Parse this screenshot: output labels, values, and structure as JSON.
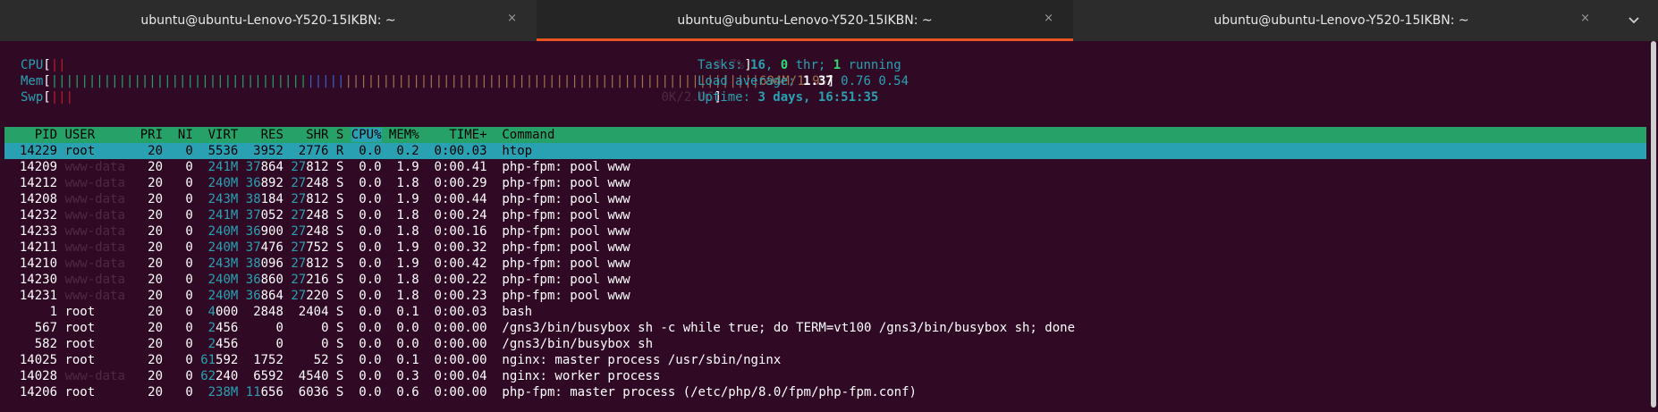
{
  "tabs": [
    {
      "title": "ubuntu@ubuntu-Lenovo-Y520-15IKBN: ~",
      "close": "×",
      "active": false
    },
    {
      "title": "ubuntu@ubuntu-Lenovo-Y520-15IKBN: ~",
      "close": "×",
      "active": true
    },
    {
      "title": "ubuntu@ubuntu-Lenovo-Y520-15IKBN: ~",
      "close": "×",
      "active": false
    }
  ],
  "tab_menu_icon": "chevron-down-icon",
  "meters": {
    "cpu_label": "CPU",
    "mem_label": "Mem",
    "mem_value": "694M/1.9",
    "swp_label": "Swp"
  },
  "summary": {
    "tasks_label": "Tasks: ",
    "tasks": "16",
    "thr_sep": ", ",
    "thr": "0",
    "thr_label": " thr; ",
    "running": "1",
    "running_label": " running",
    "load_label": "Load average: ",
    "load1": "1.37",
    "load5": "0.76",
    "load15": "0.54",
    "uptime_label": "Uptime: ",
    "uptime": "3 days, 16:51:35"
  },
  "columns": [
    "PID",
    "USER",
    "PRI",
    "NI",
    "VIRT",
    "RES",
    "SHR",
    "S",
    "CPU%",
    "MEM%",
    "TIME+",
    "Command"
  ],
  "processes": [
    {
      "pid": "14229",
      "user": "root",
      "pri": "20",
      "ni": "0",
      "virt": "5536",
      "res": "3952",
      "shr": "2776",
      "s": "R",
      "cpu": "0.0",
      "mem": "0.2",
      "time": "0:00.03",
      "cmd": "htop"
    },
    {
      "pid": "14209",
      "user": "www-data",
      "pri": "20",
      "ni": "0",
      "virt": "241M",
      "res": "37864",
      "shr": "27812",
      "s": "S",
      "cpu": "0.0",
      "mem": "1.9",
      "time": "0:00.41",
      "cmd": "php-fpm: pool www"
    },
    {
      "pid": "14212",
      "user": "www-data",
      "pri": "20",
      "ni": "0",
      "virt": "240M",
      "res": "36892",
      "shr": "27248",
      "s": "S",
      "cpu": "0.0",
      "mem": "1.8",
      "time": "0:00.29",
      "cmd": "php-fpm: pool www"
    },
    {
      "pid": "14208",
      "user": "www-data",
      "pri": "20",
      "ni": "0",
      "virt": "243M",
      "res": "38184",
      "shr": "27812",
      "s": "S",
      "cpu": "0.0",
      "mem": "1.9",
      "time": "0:00.44",
      "cmd": "php-fpm: pool www"
    },
    {
      "pid": "14232",
      "user": "www-data",
      "pri": "20",
      "ni": "0",
      "virt": "241M",
      "res": "37052",
      "shr": "27248",
      "s": "S",
      "cpu": "0.0",
      "mem": "1.8",
      "time": "0:00.24",
      "cmd": "php-fpm: pool www"
    },
    {
      "pid": "14233",
      "user": "www-data",
      "pri": "20",
      "ni": "0",
      "virt": "240M",
      "res": "36900",
      "shr": "27248",
      "s": "S",
      "cpu": "0.0",
      "mem": "1.8",
      "time": "0:00.16",
      "cmd": "php-fpm: pool www"
    },
    {
      "pid": "14211",
      "user": "www-data",
      "pri": "20",
      "ni": "0",
      "virt": "240M",
      "res": "37476",
      "shr": "27752",
      "s": "S",
      "cpu": "0.0",
      "mem": "1.9",
      "time": "0:00.32",
      "cmd": "php-fpm: pool www"
    },
    {
      "pid": "14210",
      "user": "www-data",
      "pri": "20",
      "ni": "0",
      "virt": "243M",
      "res": "38096",
      "shr": "27812",
      "s": "S",
      "cpu": "0.0",
      "mem": "1.9",
      "time": "0:00.42",
      "cmd": "php-fpm: pool www"
    },
    {
      "pid": "14230",
      "user": "www-data",
      "pri": "20",
      "ni": "0",
      "virt": "240M",
      "res": "36860",
      "shr": "27216",
      "s": "S",
      "cpu": "0.0",
      "mem": "1.8",
      "time": "0:00.22",
      "cmd": "php-fpm: pool www"
    },
    {
      "pid": "14231",
      "user": "www-data",
      "pri": "20",
      "ni": "0",
      "virt": "240M",
      "res": "36864",
      "shr": "27220",
      "s": "S",
      "cpu": "0.0",
      "mem": "1.8",
      "time": "0:00.23",
      "cmd": "php-fpm: pool www"
    },
    {
      "pid": "1",
      "user": "root",
      "pri": "20",
      "ni": "0",
      "virt": "4000",
      "res": "2848",
      "shr": "2404",
      "s": "S",
      "cpu": "0.0",
      "mem": "0.1",
      "time": "0:00.03",
      "cmd": "bash"
    },
    {
      "pid": "567",
      "user": "root",
      "pri": "20",
      "ni": "0",
      "virt": "2456",
      "res": "0",
      "shr": "0",
      "s": "S",
      "cpu": "0.0",
      "mem": "0.0",
      "time": "0:00.00",
      "cmd": "/gns3/bin/busybox sh -c while true; do TERM=vt100 /gns3/bin/busybox sh; done"
    },
    {
      "pid": "582",
      "user": "root",
      "pri": "20",
      "ni": "0",
      "virt": "2456",
      "res": "0",
      "shr": "0",
      "s": "S",
      "cpu": "0.0",
      "mem": "0.0",
      "time": "0:00.00",
      "cmd": "/gns3/bin/busybox sh"
    },
    {
      "pid": "14025",
      "user": "root",
      "pri": "20",
      "ni": "0",
      "virt": "61592",
      "res": "1752",
      "shr": "52",
      "s": "S",
      "cpu": "0.0",
      "mem": "0.1",
      "time": "0:00.00",
      "cmd": "nginx: master process /usr/sbin/nginx"
    },
    {
      "pid": "14028",
      "user": "www-data",
      "pri": "20",
      "ni": "0",
      "virt": "62240",
      "res": "6592",
      "shr": "4540",
      "s": "S",
      "cpu": "0.0",
      "mem": "0.3",
      "time": "0:00.04",
      "cmd": "nginx: worker process"
    },
    {
      "pid": "14206",
      "user": "root",
      "pri": "20",
      "ni": "0",
      "virt": "238M",
      "res": "11656",
      "shr": "6036",
      "s": "S",
      "cpu": "0.0",
      "mem": "0.6",
      "time": "0:00.00",
      "cmd": "php-fpm: master process (/etc/php/8.0/fpm/php-fpm.conf)"
    }
  ],
  "colors": {
    "terminal_bg": "#300a24",
    "header_bg": "#26a269",
    "selection_bg": "#2aa1b3",
    "tab_accent": "#e95420"
  }
}
